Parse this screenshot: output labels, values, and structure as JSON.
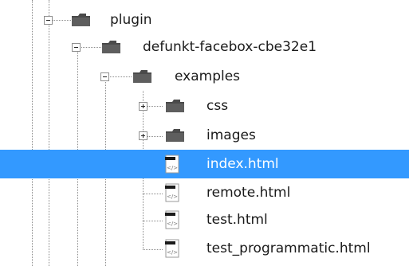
{
  "tree": {
    "plugin": {
      "label": "plugin",
      "icon": "folder-icon",
      "expanded": true
    },
    "facebox": {
      "label": "defunkt-facebox-cbe32e1",
      "icon": "folder-icon",
      "expanded": true
    },
    "examples": {
      "label": "examples",
      "icon": "folder-icon",
      "expanded": true
    },
    "css": {
      "label": "css",
      "icon": "folder-icon",
      "expanded": false
    },
    "images": {
      "label": "images",
      "icon": "folder-icon",
      "expanded": false
    },
    "files": [
      {
        "label": "index.html",
        "icon": "html-file-icon",
        "selected": true
      },
      {
        "label": "remote.html",
        "icon": "html-file-icon",
        "selected": false
      },
      {
        "label": "test.html",
        "icon": "html-file-icon",
        "selected": false
      },
      {
        "label": "test_programmatic.html",
        "icon": "html-file-icon",
        "selected": false
      }
    ]
  },
  "colors": {
    "selection": "#3399ff",
    "selected_text": "#ffffff",
    "folder": "#4a4a4a"
  }
}
